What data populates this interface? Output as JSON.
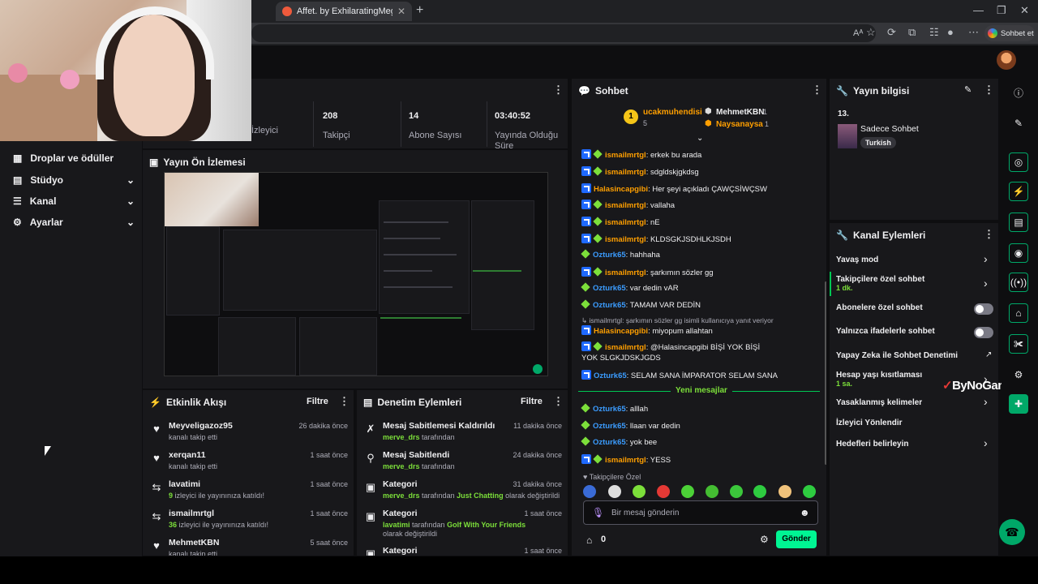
{
  "browser": {
    "tab_title": "Affet. by ExhilaratingMegaphones",
    "new_tab_symbol": "+",
    "copilot_label": "Sohbet et"
  },
  "nav": {
    "items": [
      {
        "label": "Droplar ve ödüller",
        "icon": "gift-icon"
      },
      {
        "label": "Stüdyo",
        "icon": "studio-icon"
      },
      {
        "label": "Kanal",
        "icon": "channel-icon"
      },
      {
        "label": "Ayarlar",
        "icon": "gear-icon"
      }
    ]
  },
  "stats": {
    "viewers_label": "İzleyici",
    "followers_value": "208",
    "followers_label": "Takipçi",
    "subs_value": "14",
    "subs_label": "Abone Sayısı",
    "uptime_value": "03:40:52",
    "uptime_label": "Yayında Olduğu Süre"
  },
  "preview": {
    "title": "Yayın Ön İzlemesi"
  },
  "activity": {
    "title": "Etkinlik Akışı",
    "filter": "Filtre",
    "items": [
      {
        "name": "Meyveligazoz95",
        "desc": "kanalı takip etti",
        "time": "26 dakika önce",
        "icon": "heart-icon"
      },
      {
        "name": "xerqan11",
        "desc": "kanalı takip etti",
        "time": "1 saat önce",
        "icon": "heart-icon"
      },
      {
        "name": "lavatimi",
        "count": "9",
        "desc": " izleyici ile yayınınıza katıldı!",
        "time": "1 saat önce",
        "icon": "raid-icon"
      },
      {
        "name": "ismailmrtgl",
        "count": "36",
        "desc": " izleyici ile yayınınıza katıldı!",
        "time": "1 saat önce",
        "icon": "raid-icon"
      },
      {
        "name": "MehmetKBN",
        "desc": "kanalı takip etti",
        "time": "5 saat önce",
        "icon": "heart-icon"
      }
    ]
  },
  "moderation": {
    "title": "Denetim Eylemleri",
    "filter": "Filtre",
    "items": [
      {
        "title": "Mesaj Sabitlemesi Kaldırıldı",
        "user": "merve_drs",
        "suffix": " tarafından",
        "time": "11 dakika önce",
        "icon": "unpin-icon"
      },
      {
        "title": "Mesaj Sabitlendi",
        "user": "merve_drs",
        "suffix": " tarafından",
        "time": "24 dakika önce",
        "icon": "pin-icon"
      },
      {
        "title": "Kategori",
        "user": "merve_drs",
        "suffix": " tarafından ",
        "game": "Just Chatting",
        "suffix2": " olarak değiştirildi",
        "time": "31 dakika önce",
        "icon": "category-icon"
      },
      {
        "title": "Kategori",
        "user": "lavatimi",
        "suffix": " tarafından ",
        "game": "Golf With Your Friends",
        "suffix2": " olarak değiştirildi",
        "time": "1 saat önce",
        "icon": "category-icon"
      },
      {
        "title": "Kategori",
        "time": "1 saat önce",
        "icon": "category-icon"
      }
    ]
  },
  "chat": {
    "title": "Sohbet",
    "leader1_name": "ucakmuhendisi",
    "leader1_rank": "1",
    "leader1_score": "5",
    "leader2_name": "MehmetKBN",
    "leader2_score": "1",
    "leader3_name": "Naysanaysa",
    "leader3_score": "1",
    "messages": [
      {
        "user": "ismailmrtgl",
        "color": "or",
        "text": ": erkek bu arada",
        "badges": "bg"
      },
      {
        "user": "ismailmrtgl",
        "color": "or",
        "text": ": sdgldskjgkdsg",
        "badges": "bg"
      },
      {
        "user": "Halasincapgibi",
        "color": "or",
        "text": ": Her şeyi açıkladı ÇAWÇSİWÇSW",
        "badges": "b"
      },
      {
        "user": "ismailmrtgl",
        "color": "or",
        "text": ": vallaha",
        "badges": "bg"
      },
      {
        "user": "ismailmrtgl",
        "color": "or",
        "text": ": nE",
        "badges": "bg"
      },
      {
        "user": "ismailmrtgl",
        "color": "or",
        "text": ": KLDSGKJSDHLKJSDH",
        "badges": "bg"
      },
      {
        "user": "Ozturk65",
        "color": "bl",
        "text": ": hahhaha",
        "badges": "g"
      },
      {
        "user": "ismailmrtgl",
        "color": "or",
        "text": ": şarkımın sözler gg",
        "badges": "bg"
      },
      {
        "user": "Ozturk65",
        "color": "bl",
        "text": ": var dedin vAR",
        "badges": "g"
      },
      {
        "user": "Ozturk65",
        "color": "bl",
        "text": ": TAMAM VAR DEDİN",
        "badges": "g"
      }
    ],
    "reply_note": "↳ ismailmrtgl: şarkımın sözler gg isimli kullanıcıya yanıt veriyor",
    "reply_msg": {
      "user": "Halasincapgibi",
      "text": ": miyopum allahtan"
    },
    "msg_long_user": "ismailmrtgl",
    "msg_long_text": ": @Halasincapgibi BİŞİ YOK BİŞİ YOK SLGKJDSKJGDS",
    "msg_selam_user": "Ozturk65",
    "msg_selam_text": ": SELAM SANA İMPARATOR SELAM SANA",
    "new_messages": "Yeni mesajlar",
    "new_lines": [
      {
        "user": "Ozturk65",
        "text": ": alllah",
        "badges": "g"
      },
      {
        "user": "Ozturk65",
        "text": ": llaan var dedin",
        "badges": "g"
      },
      {
        "user": "Ozturk65",
        "text": ": yok bee",
        "badges": "g"
      },
      {
        "user": "ismailmrtgl",
        "text": ": YESS",
        "badges": "bg"
      }
    ],
    "followers_only": "Takipçilere Özel",
    "input_placeholder": "Bir mesaj gönderin",
    "points": "0",
    "send": "Gönder"
  },
  "stream_info": {
    "title": "Yayın bilgisi",
    "number": "13.",
    "stream_title": "Sadece Sohbet",
    "tag": "Turkish"
  },
  "channel_actions": {
    "title": "Kanal Eylemleri",
    "items": [
      {
        "label": "Yavaş mod",
        "ctrl": "chevron"
      },
      {
        "label": "Takipçilere özel sohbet",
        "sub": "1 dk.",
        "ctrl": "chevron"
      },
      {
        "label": "Abonelere özel sohbet",
        "ctrl": "toggle"
      },
      {
        "label": "Yalnızca ifadelerle sohbet",
        "ctrl": "toggle"
      },
      {
        "label": "Yapay Zeka ile Sohbet Denetimi",
        "ctrl": "external"
      },
      {
        "label": "Hesap yaşı kısıtlaması",
        "sub": "1 sa.",
        "ctrl": "chevron"
      },
      {
        "label": "Yasaklanmış kelimeler",
        "ctrl": "chevron"
      },
      {
        "label": "İzleyici Yönlendir",
        "ctrl": "none"
      },
      {
        "label": "Hedefleri belirleyin",
        "ctrl": "chevron"
      }
    ]
  },
  "watermark": "ByNoGame",
  "colors": {
    "accent": "#00f593",
    "chat_green": "#7cdf3a",
    "orange": "#ff9f00",
    "blue": "#3b9cff"
  }
}
